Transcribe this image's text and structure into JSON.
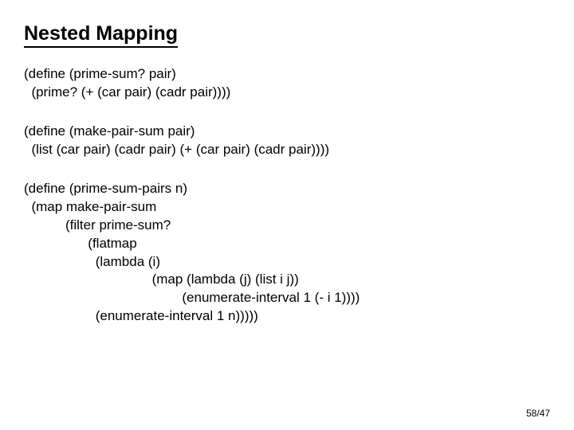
{
  "title": "Nested Mapping",
  "blocks": {
    "b1": "(define (prime-sum? pair)\n  (prime? (+ (car pair) (cadr pair))))",
    "b2": "(define (make-pair-sum pair)\n  (list (car pair) (cadr pair) (+ (car pair) (cadr pair))))",
    "b3": "(define (prime-sum-pairs n)\n  (map make-pair-sum\n           (filter prime-sum?\n                 (flatmap\n                   (lambda (i)\n                                  (map (lambda (j) (list i j))\n                                          (enumerate-interval 1 (- i 1))))\n                   (enumerate-interval 1 n)))))"
  },
  "page_number": "58/47"
}
